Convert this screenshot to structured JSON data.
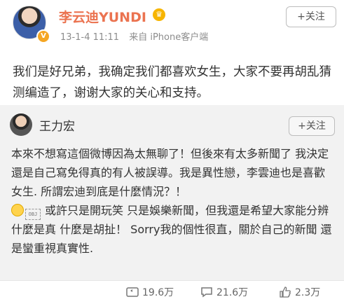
{
  "post": {
    "author": "李云迪YUNDI",
    "timestamp": "13-1-4 11:11",
    "source": "来自 iPhone客户端",
    "follow_label": "+关注",
    "text": "我们是好兄弟，我确定我们都喜欢女生，大家不要再胡乱猜测编造了，谢谢大家的关心和支持。",
    "verified_badge": "V"
  },
  "repost": {
    "author": "王力宏",
    "follow_label": "+关注",
    "text_part1": "本來不想寫這個微博因為太無聊了！但後來有太多新聞了 我決定還是自己寫免得真的有人被誤導。我是異性戀，李雲迪也是喜歡女生. 所謂宏迪到底是什麼情況？！",
    "obj_label": "OBJ",
    "text_part2": "或許只是開玩笑 只是娛樂新聞，但我還是希望大家能分辨什麼是真 什麼是胡扯！ Sorry我的個性很直，關於自己的新聞 還是蠻重視真實性."
  },
  "actions": {
    "repost_count": "19.6万",
    "comment_count": "21.6万",
    "like_count": "2.3万"
  },
  "colors": {
    "author_name": "#eb7350",
    "repost_bg": "#f2f2f2",
    "meta_text": "#8c8c8c"
  },
  "icons": [
    "verified-icon",
    "crown-icon",
    "repost-icon",
    "comment-icon",
    "like-icon",
    "smile-emoji-icon"
  ]
}
